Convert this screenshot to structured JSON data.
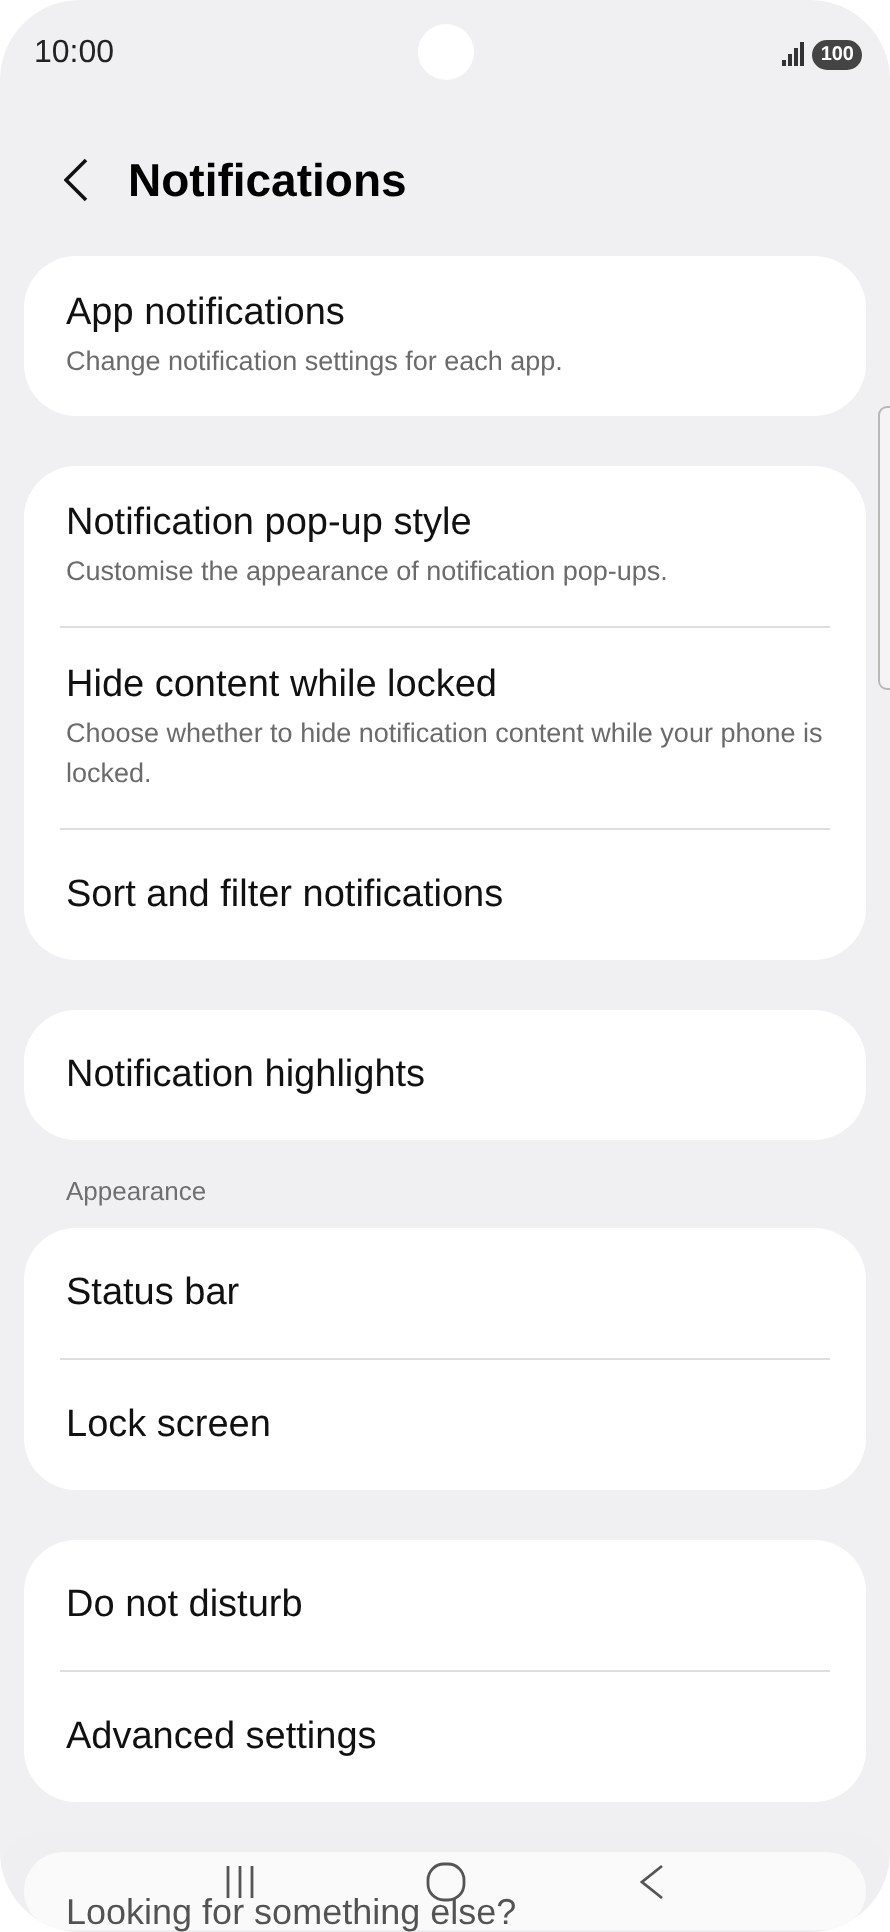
{
  "status_bar": {
    "time": "10:00",
    "battery": "100"
  },
  "header": {
    "title": "Notifications"
  },
  "groups": [
    {
      "items": [
        {
          "title": "App notifications",
          "subtitle": "Change notification settings for each app."
        }
      ]
    },
    {
      "items": [
        {
          "title": "Notification pop-up style",
          "subtitle": "Customise the appearance of notification pop-ups."
        },
        {
          "title": "Hide content while locked",
          "subtitle": "Choose whether to hide notification content while your phone is locked."
        },
        {
          "title": "Sort and filter notifications"
        }
      ]
    },
    {
      "items": [
        {
          "title": "Notification highlights"
        }
      ]
    },
    {
      "header": "Appearance",
      "items": [
        {
          "title": "Status bar"
        },
        {
          "title": "Lock screen"
        }
      ]
    },
    {
      "items": [
        {
          "title": "Do not disturb"
        },
        {
          "title": "Advanced settings"
        }
      ]
    },
    {
      "items": [
        {
          "title": "Looking for something else?"
        }
      ]
    }
  ]
}
